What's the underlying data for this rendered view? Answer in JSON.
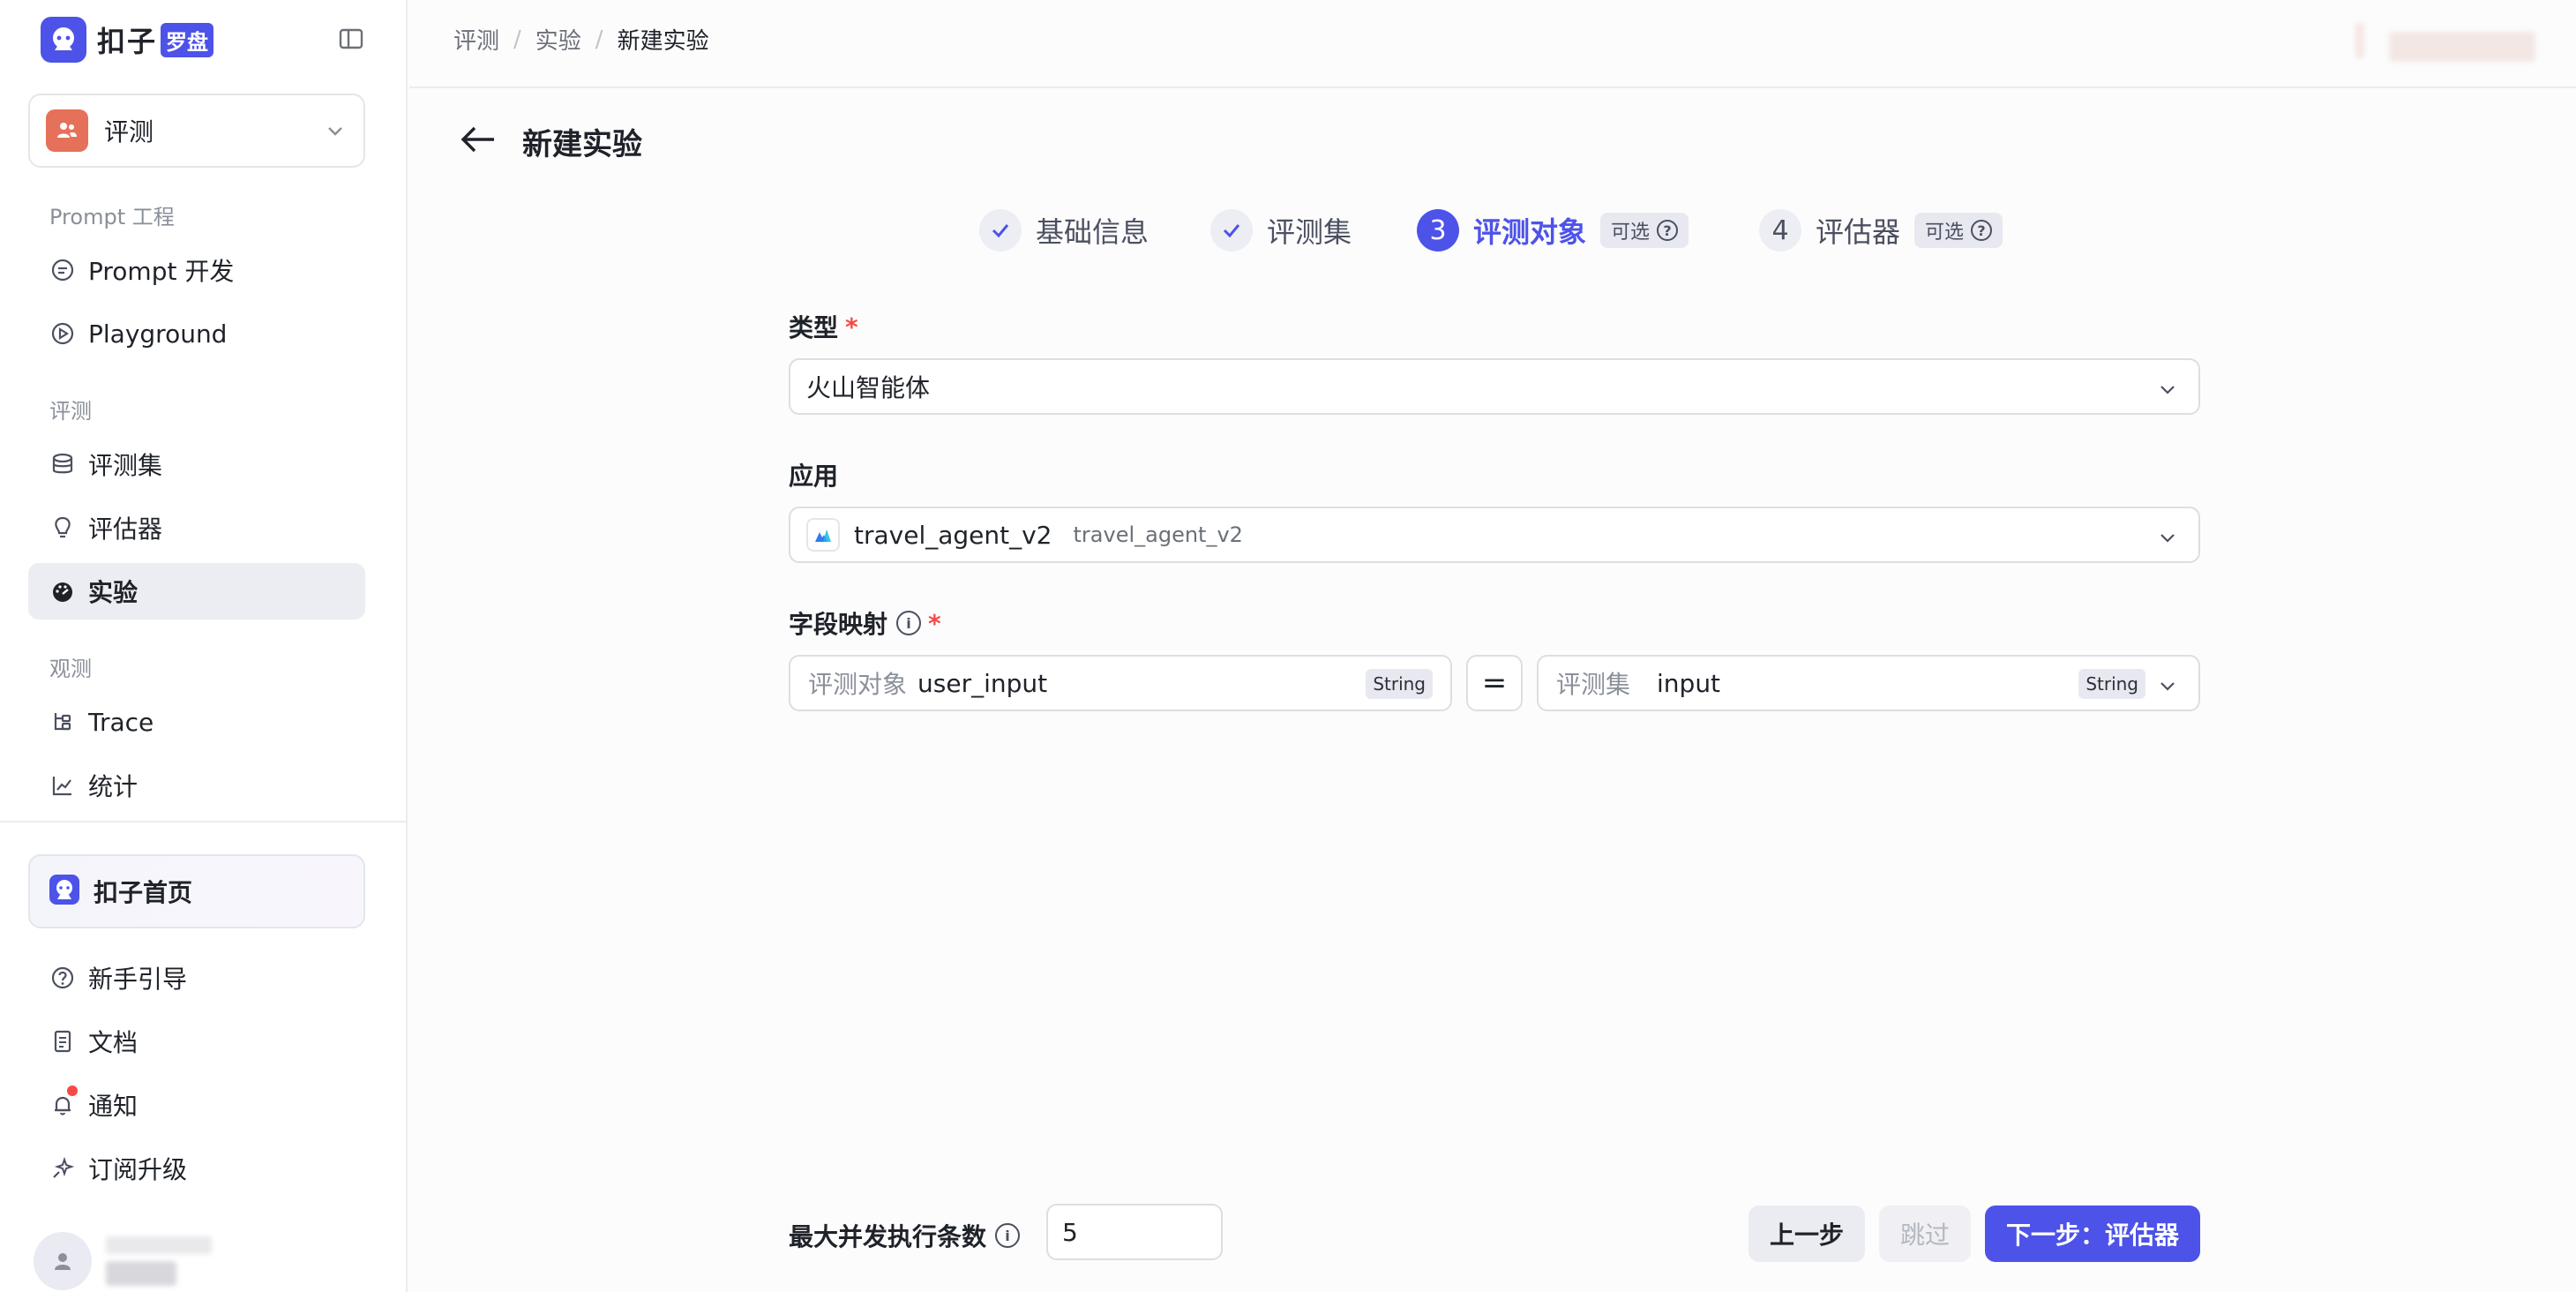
{
  "brand": {
    "name": "扣子",
    "badge": "罗盘"
  },
  "space": {
    "name": "评测"
  },
  "sidebar": {
    "sections": [
      {
        "title": "Prompt 工程"
      },
      {
        "title": "评测"
      },
      {
        "title": "观测"
      }
    ],
    "items": [
      {
        "label": "Prompt 开发",
        "icon": "chat-bubble-icon"
      },
      {
        "label": "Playground",
        "icon": "play-circle-icon"
      },
      {
        "label": "评测集",
        "icon": "database-icon"
      },
      {
        "label": "评估器",
        "icon": "lightbulb-icon"
      },
      {
        "label": "实验",
        "icon": "dashboard-icon",
        "active": true
      },
      {
        "label": "Trace",
        "icon": "trace-tree-icon"
      },
      {
        "label": "统计",
        "icon": "chart-icon"
      }
    ],
    "home": {
      "label": "扣子首页"
    },
    "bottom_items": [
      {
        "label": "新手引导",
        "icon": "help-circle-icon"
      },
      {
        "label": "文档",
        "icon": "document-icon"
      },
      {
        "label": "通知",
        "icon": "bell-icon"
      },
      {
        "label": "订阅升级",
        "icon": "sparkle-icon"
      }
    ]
  },
  "breadcrumb": [
    "评测",
    "实验",
    "新建实验"
  ],
  "page": {
    "title": "新建实验"
  },
  "steps": [
    {
      "label": "基础信息",
      "status": "done"
    },
    {
      "label": "评测集",
      "status": "done"
    },
    {
      "number": "3",
      "label": "评测对象",
      "status": "current",
      "optional": "可选"
    },
    {
      "number": "4",
      "label": "评估器",
      "status": "pending",
      "optional": "可选"
    }
  ],
  "form": {
    "type": {
      "label": "类型",
      "value": "火山智能体"
    },
    "app": {
      "label": "应用",
      "value": "travel_agent_v2",
      "sub": "travel_agent_v2"
    },
    "mapping": {
      "label": "字段映射",
      "left": {
        "prefix": "评测对象",
        "field": "user_input",
        "type": "String"
      },
      "operator": "=",
      "right": {
        "prefix": "评测集",
        "field": "input",
        "type": "String"
      }
    }
  },
  "footer": {
    "concurrency_label": "最大并发执行条数",
    "concurrency_value": "5",
    "prev_label": "上一步",
    "skip_label": "跳过",
    "next_label": "下一步：评估器"
  },
  "colors": {
    "accent": "#4d53e8",
    "required": "#f54a45",
    "space_avatar": "#e6715a"
  }
}
